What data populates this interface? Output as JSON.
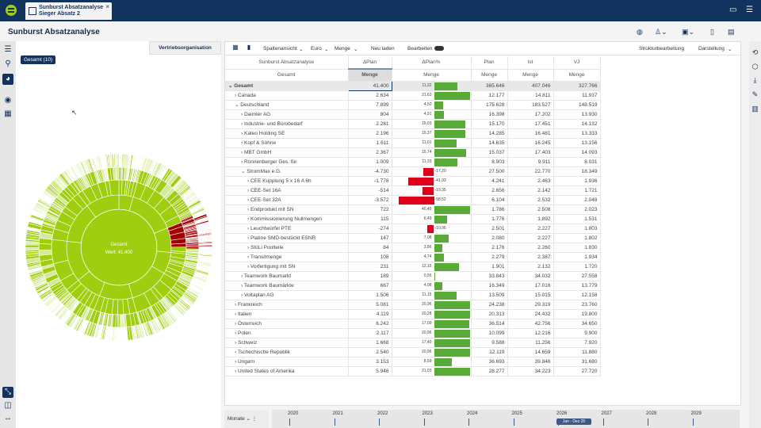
{
  "header": {
    "tab_title": "Sunburst Absatzanalyse",
    "tab_subtitle": "Sieger Absatz 2",
    "close": "×"
  },
  "page": {
    "title": "Sunburst Absatzanalyse"
  },
  "left": {
    "tab": "Vertriebsorganisation",
    "chip": "Gesamt (10)",
    "sunburst": {
      "center_label": "Gesamt",
      "center_value": "Wert: 41.400",
      "colors": {
        "positive": "#9fcd0f",
        "light": "#d5e99a",
        "negative": "#a00000"
      }
    }
  },
  "toolbar": {
    "view": "Spaltenansicht",
    "currency": "Euro",
    "measure": "Menge",
    "reload": "Neu laden",
    "edit": "Bearbeiten",
    "structure": "Strukturbearbeitung",
    "display": "Darstellung"
  },
  "table": {
    "headers": [
      "Sunburst Absatzanalyse",
      "ΔPlan",
      "ΔPlan%",
      "Plan",
      "Ist",
      "VJ"
    ],
    "subheaders": [
      "Gesamt",
      "Menge",
      "Menge",
      "Menge",
      "Menge",
      "Menge"
    ],
    "rows": [
      {
        "name": "Gesamt",
        "level": 0,
        "open": true,
        "dp": "41.400",
        "pct": 11.32,
        "pct_label": "11,32",
        "plan": "365.646",
        "ist": "407.046",
        "vj": "327.766"
      },
      {
        "name": "Canada",
        "level": 1,
        "open": false,
        "dp": "2.634",
        "pct": 21.63,
        "pct_label": "21,63",
        "plan": "12.177",
        "ist": "14.811",
        "vj": "11.937"
      },
      {
        "name": "Deutschland",
        "level": 1,
        "open": true,
        "dp": "7.899",
        "pct": 4.5,
        "pct_label": "4,50",
        "plan": "175.628",
        "ist": "183.527",
        "vj": "148.519"
      },
      {
        "name": "Daimler AG",
        "level": 2,
        "open": false,
        "dp": "804",
        "pct": 4.91,
        "pct_label": "4,91",
        "plan": "16.398",
        "ist": "17.202",
        "vj": "13.930"
      },
      {
        "name": "Industrie- und Bürobedarf",
        "level": 2,
        "open": false,
        "dp": "2.281",
        "pct": 15.03,
        "pct_label": "15,03",
        "plan": "15.170",
        "ist": "17.451",
        "vj": "14.132"
      },
      {
        "name": "Kateo Holding SE",
        "level": 2,
        "open": false,
        "dp": "2.196",
        "pct": 15.37,
        "pct_label": "15,37",
        "plan": "14.285",
        "ist": "16.481",
        "vj": "13.333"
      },
      {
        "name": "Kopf & Söhne",
        "level": 2,
        "open": false,
        "dp": "1.611",
        "pct": 11.01,
        "pct_label": "11,01",
        "plan": "14.635",
        "ist": "16.245",
        "vj": "13.156"
      },
      {
        "name": "MBT GmbH",
        "level": 2,
        "open": false,
        "dp": "2.367",
        "pct": 15.74,
        "pct_label": "15,74",
        "plan": "15.037",
        "ist": "17.403",
        "vj": "14.093"
      },
      {
        "name": "Ronnenberger Ges. für",
        "level": 2,
        "open": false,
        "dp": "1.009",
        "pct": 11.33,
        "pct_label": "11,33",
        "plan": "8.903",
        "ist": "9.911",
        "vj": "8.031"
      },
      {
        "name": "StromMax e.G.",
        "level": 2,
        "open": true,
        "dp": "-4.730",
        "pct": -17.2,
        "pct_label": "-17,20",
        "plan": "27.500",
        "ist": "22.770",
        "vj": "18.349"
      },
      {
        "name": "CEE Kupplung 5 x 16 A 6h",
        "level": 3,
        "open": false,
        "dp": "-1.778",
        "pct": -41.93,
        "pct_label": "-41,93",
        "plan": "4.241",
        "ist": "2.463",
        "vj": "1.936"
      },
      {
        "name": "CEE-Set 16A",
        "level": 3,
        "open": false,
        "dp": "-514",
        "pct": -19.35,
        "pct_label": "-19,35",
        "plan": "2.656",
        "ist": "2.142",
        "vj": "1.721"
      },
      {
        "name": "CEE-Set 32A",
        "level": 3,
        "open": false,
        "dp": "-3.572",
        "pct": -58.52,
        "pct_label": "-58,52",
        "plan": "6.104",
        "ist": "2.532",
        "vj": "2.048"
      },
      {
        "name": "Endprodukt mit SN",
        "level": 3,
        "open": false,
        "dp": "722",
        "pct": 40.45,
        "pct_label": "40,45",
        "plan": "1.786",
        "ist": "2.508",
        "vj": "2.023"
      },
      {
        "name": "Kommissionierung Nullmengen",
        "level": 3,
        "open": false,
        "dp": "115",
        "pct": 6.49,
        "pct_label": "6,49",
        "plan": "1.776",
        "ist": "1.892",
        "vj": "1.531"
      },
      {
        "name": "Leuchtwürfel PTE",
        "level": 3,
        "open": false,
        "dp": "-274",
        "pct": -10.96,
        "pct_label": "-10,96",
        "plan": "2.501",
        "ist": "2.227",
        "vj": "1.803"
      },
      {
        "name": "Platine SMD-bestückt ESNR",
        "level": 3,
        "open": false,
        "dp": "147",
        "pct": 7.08,
        "pct_label": "7,08",
        "plan": "2.080",
        "ist": "2.227",
        "vj": "1.802"
      },
      {
        "name": "StüLi Poolteile",
        "level": 3,
        "open": false,
        "dp": "84",
        "pct": 3.86,
        "pct_label": "3,86",
        "plan": "2.176",
        "ist": "2.260",
        "vj": "1.830"
      },
      {
        "name": "Transitmenge",
        "level": 3,
        "open": false,
        "dp": "108",
        "pct": 4.74,
        "pct_label": "4,74",
        "plan": "2.279",
        "ist": "2.387",
        "vj": "1.934"
      },
      {
        "name": "Vorfertigung mit SN",
        "level": 3,
        "open": false,
        "dp": "231",
        "pct": 12.15,
        "pct_label": "12,15",
        "plan": "1.901",
        "ist": "2.132",
        "vj": "1.720"
      },
      {
        "name": "Teamwork Baumarkt",
        "level": 2,
        "open": false,
        "dp": "189",
        "pct": 0.56,
        "pct_label": "0,56",
        "plan": "33.843",
        "ist": "34.032",
        "vj": "27.558"
      },
      {
        "name": "Teamwork Baumärkte",
        "level": 2,
        "open": false,
        "dp": "667",
        "pct": 4.08,
        "pct_label": "4,08",
        "plan": "16.349",
        "ist": "17.016",
        "vj": "13.779"
      },
      {
        "name": "Voltaplan AG",
        "level": 2,
        "open": false,
        "dp": "1.506",
        "pct": 11.15,
        "pct_label": "11,15",
        "plan": "13.509",
        "ist": "15.015",
        "vj": "12.158"
      },
      {
        "name": "Frankreich",
        "level": 1,
        "open": false,
        "dp": "5.081",
        "pct": 20.96,
        "pct_label": "20,96",
        "plan": "24.238",
        "ist": "29.319",
        "vj": "23.760"
      },
      {
        "name": "Italien",
        "level": 1,
        "open": false,
        "dp": "4.119",
        "pct": 20.28,
        "pct_label": "20,28",
        "plan": "20.313",
        "ist": "24.432",
        "vj": "19.800"
      },
      {
        "name": "Österreich",
        "level": 1,
        "open": false,
        "dp": "6.242",
        "pct": 17.09,
        "pct_label": "17,09",
        "plan": "36.514",
        "ist": "42.756",
        "vj": "34.650"
      },
      {
        "name": "Polen",
        "level": 1,
        "open": false,
        "dp": "2.117",
        "pct": 20.96,
        "pct_label": "20,96",
        "plan": "10.099",
        "ist": "12.216",
        "vj": "9.900"
      },
      {
        "name": "Schweiz",
        "level": 1,
        "open": false,
        "dp": "1.668",
        "pct": 17.4,
        "pct_label": "17,40",
        "plan": "9.588",
        "ist": "11.256",
        "vj": "7.920"
      },
      {
        "name": "Tschechische Republik",
        "level": 1,
        "open": false,
        "dp": "2.540",
        "pct": 20.96,
        "pct_label": "20,96",
        "plan": "12.119",
        "ist": "14.659",
        "vj": "11.880"
      },
      {
        "name": "Ungarn",
        "level": 1,
        "open": false,
        "dp": "3.153",
        "pct": 8.59,
        "pct_label": "8,59",
        "plan": "36.693",
        "ist": "39.846",
        "vj": "31.680"
      },
      {
        "name": "United States of Amerika",
        "level": 1,
        "open": false,
        "dp": "5.946",
        "pct": 21.03,
        "pct_label": "21,03",
        "plan": "28.277",
        "ist": "34.223",
        "vj": "27.720"
      }
    ],
    "colors": {
      "positive": "#5aaa37",
      "negative": "#e0001b"
    }
  },
  "timeline": {
    "unit": "Monate",
    "years": [
      "2020",
      "2021",
      "2022",
      "2023",
      "2024",
      "2025",
      "2026",
      "2027",
      "2028",
      "2029"
    ],
    "range": "Jan - Dez 25"
  }
}
